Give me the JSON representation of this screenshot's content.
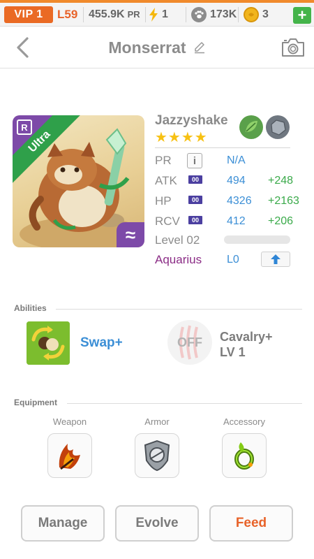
{
  "status_bar": {
    "vip_label": "VIP 1",
    "level_label": "L59",
    "power_rating": "455.9K",
    "power_rating_unit": "PR",
    "energy": "1",
    "paw_count": "173K",
    "coin_count": "3",
    "add_button_label": "+",
    "accent_color": "#f08a2c",
    "vip_color": "#ea6a24",
    "add_color": "#44b44a"
  },
  "header": {
    "title": "Monserrat",
    "back_icon": "chevron-left-icon",
    "edit_icon": "pencil-icon",
    "camera_icon": "camera-icon"
  },
  "card": {
    "rarity_label": "Ultra",
    "rarity_badge": "R",
    "sign_badge": "≈",
    "name": "Jazzyshake",
    "stars": "★★★★",
    "star_count": 4,
    "elements": [
      "leaf-element-icon",
      "stone-element-icon"
    ],
    "stats": [
      {
        "label": "PR",
        "value": "N/A",
        "bonus": "",
        "badge": "i"
      },
      {
        "label": "ATK",
        "value": "494",
        "bonus": "+248",
        "badge": "00"
      },
      {
        "label": "HP",
        "value": "4326",
        "bonus": "+2163",
        "badge": "00"
      },
      {
        "label": "RCV",
        "value": "412",
        "bonus": "+206",
        "badge": "00"
      }
    ],
    "level_label": "Level 02",
    "level_progress": 0.0,
    "sign_name": "Aquarius",
    "sign_level": "L0",
    "upgrade_icon": "arrow-up-icon"
  },
  "abilities": {
    "section_title": "Abilities",
    "skill_name": "Swap+",
    "leader_status": "OFF",
    "leader_name_line1": "Cavalry+",
    "leader_name_line2": "LV 1"
  },
  "equipment": {
    "section_title": "Equipment",
    "slots": [
      {
        "label": "Weapon",
        "icon": "flame-claw-icon"
      },
      {
        "label": "Armor",
        "icon": "armor-shield-icon"
      },
      {
        "label": "Accessory",
        "icon": "green-ring-icon"
      }
    ]
  },
  "actions": {
    "manage": "Manage",
    "evolve": "Evolve",
    "feed": "Feed"
  }
}
